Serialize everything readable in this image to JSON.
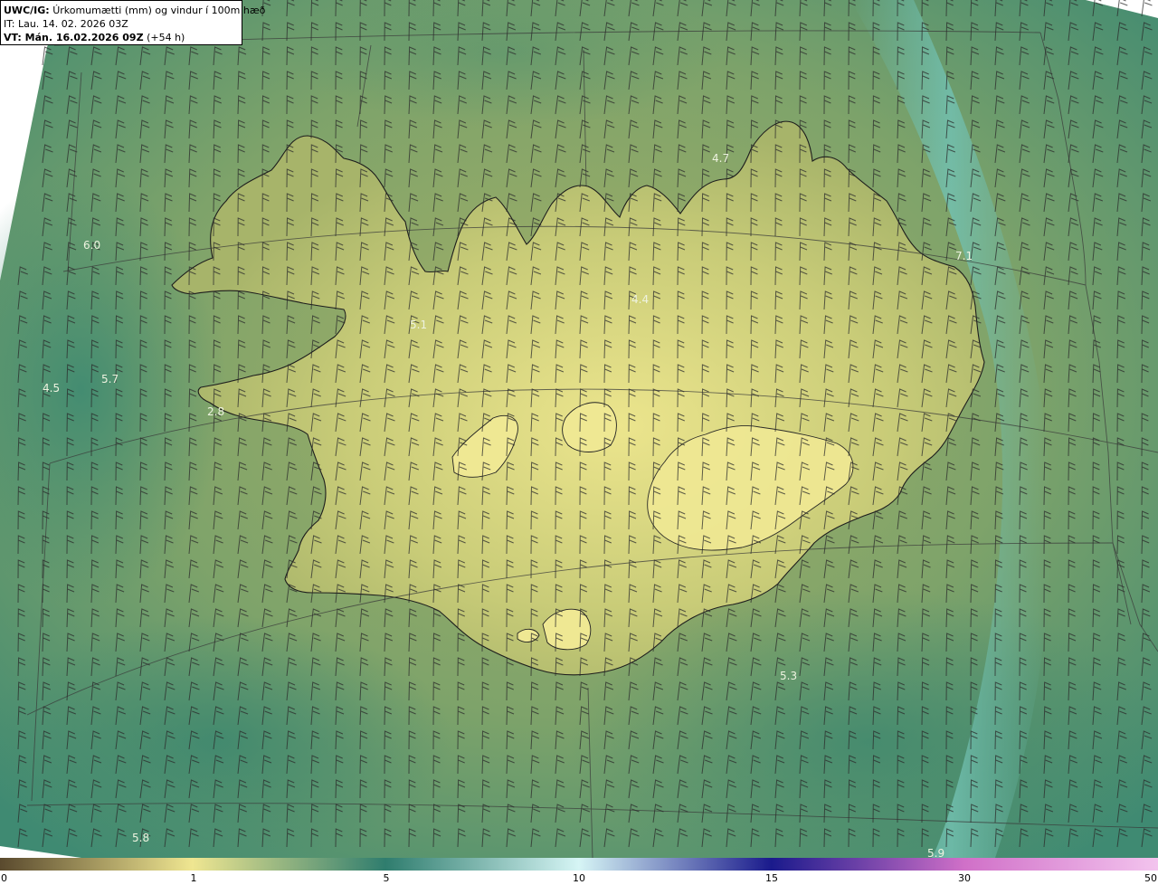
{
  "header": {
    "model": "UWC/IG:",
    "title": "Úrkomumætti (mm) og vindur í 100m hæð",
    "it_label": "IT:",
    "it_value": "Lau. 14. 02. 2026 03Z",
    "vt_label": "VT: Mán. 16.02.2026 09Z",
    "vt_offset": "(+54 h)"
  },
  "map_labels": [
    {
      "text": "4.7",
      "name": "value-label-north"
    },
    {
      "text": "6.0",
      "name": "value-label-northwest-sea"
    },
    {
      "text": "7.1",
      "name": "value-label-northeast-sea"
    },
    {
      "text": "5.1",
      "name": "value-label-westfjords"
    },
    {
      "text": "4.4",
      "name": "value-label-north-interior"
    },
    {
      "text": "5.7",
      "name": "value-label-west-sea"
    },
    {
      "text": "4.5",
      "name": "value-label-far-west"
    },
    {
      "text": "2.8",
      "name": "value-label-snaefellsnes"
    },
    {
      "text": "5.3",
      "name": "value-label-south-sea"
    },
    {
      "text": "5.8",
      "name": "value-label-southwest-corner"
    },
    {
      "text": "5.9",
      "name": "value-label-southeast-corner"
    }
  ],
  "colorbar": {
    "ticks": [
      "0",
      "1",
      "5",
      "10",
      "15",
      "30",
      "50"
    ],
    "colors": {
      "c0": "#5a4a2e",
      "c1": "#efe691",
      "c5": "#2f7d6e",
      "c10": "#d6f5f5",
      "c15": "#1a1a8c",
      "c30": "#d070c8",
      "c50": "#f3c4ee"
    }
  },
  "palette": {
    "sea_deep": "#3e8a70",
    "sea_mid": "#6f9f6a",
    "land_low": "#9aab63",
    "land_high": "#e9e48c",
    "current_band": "#69b6a6"
  }
}
